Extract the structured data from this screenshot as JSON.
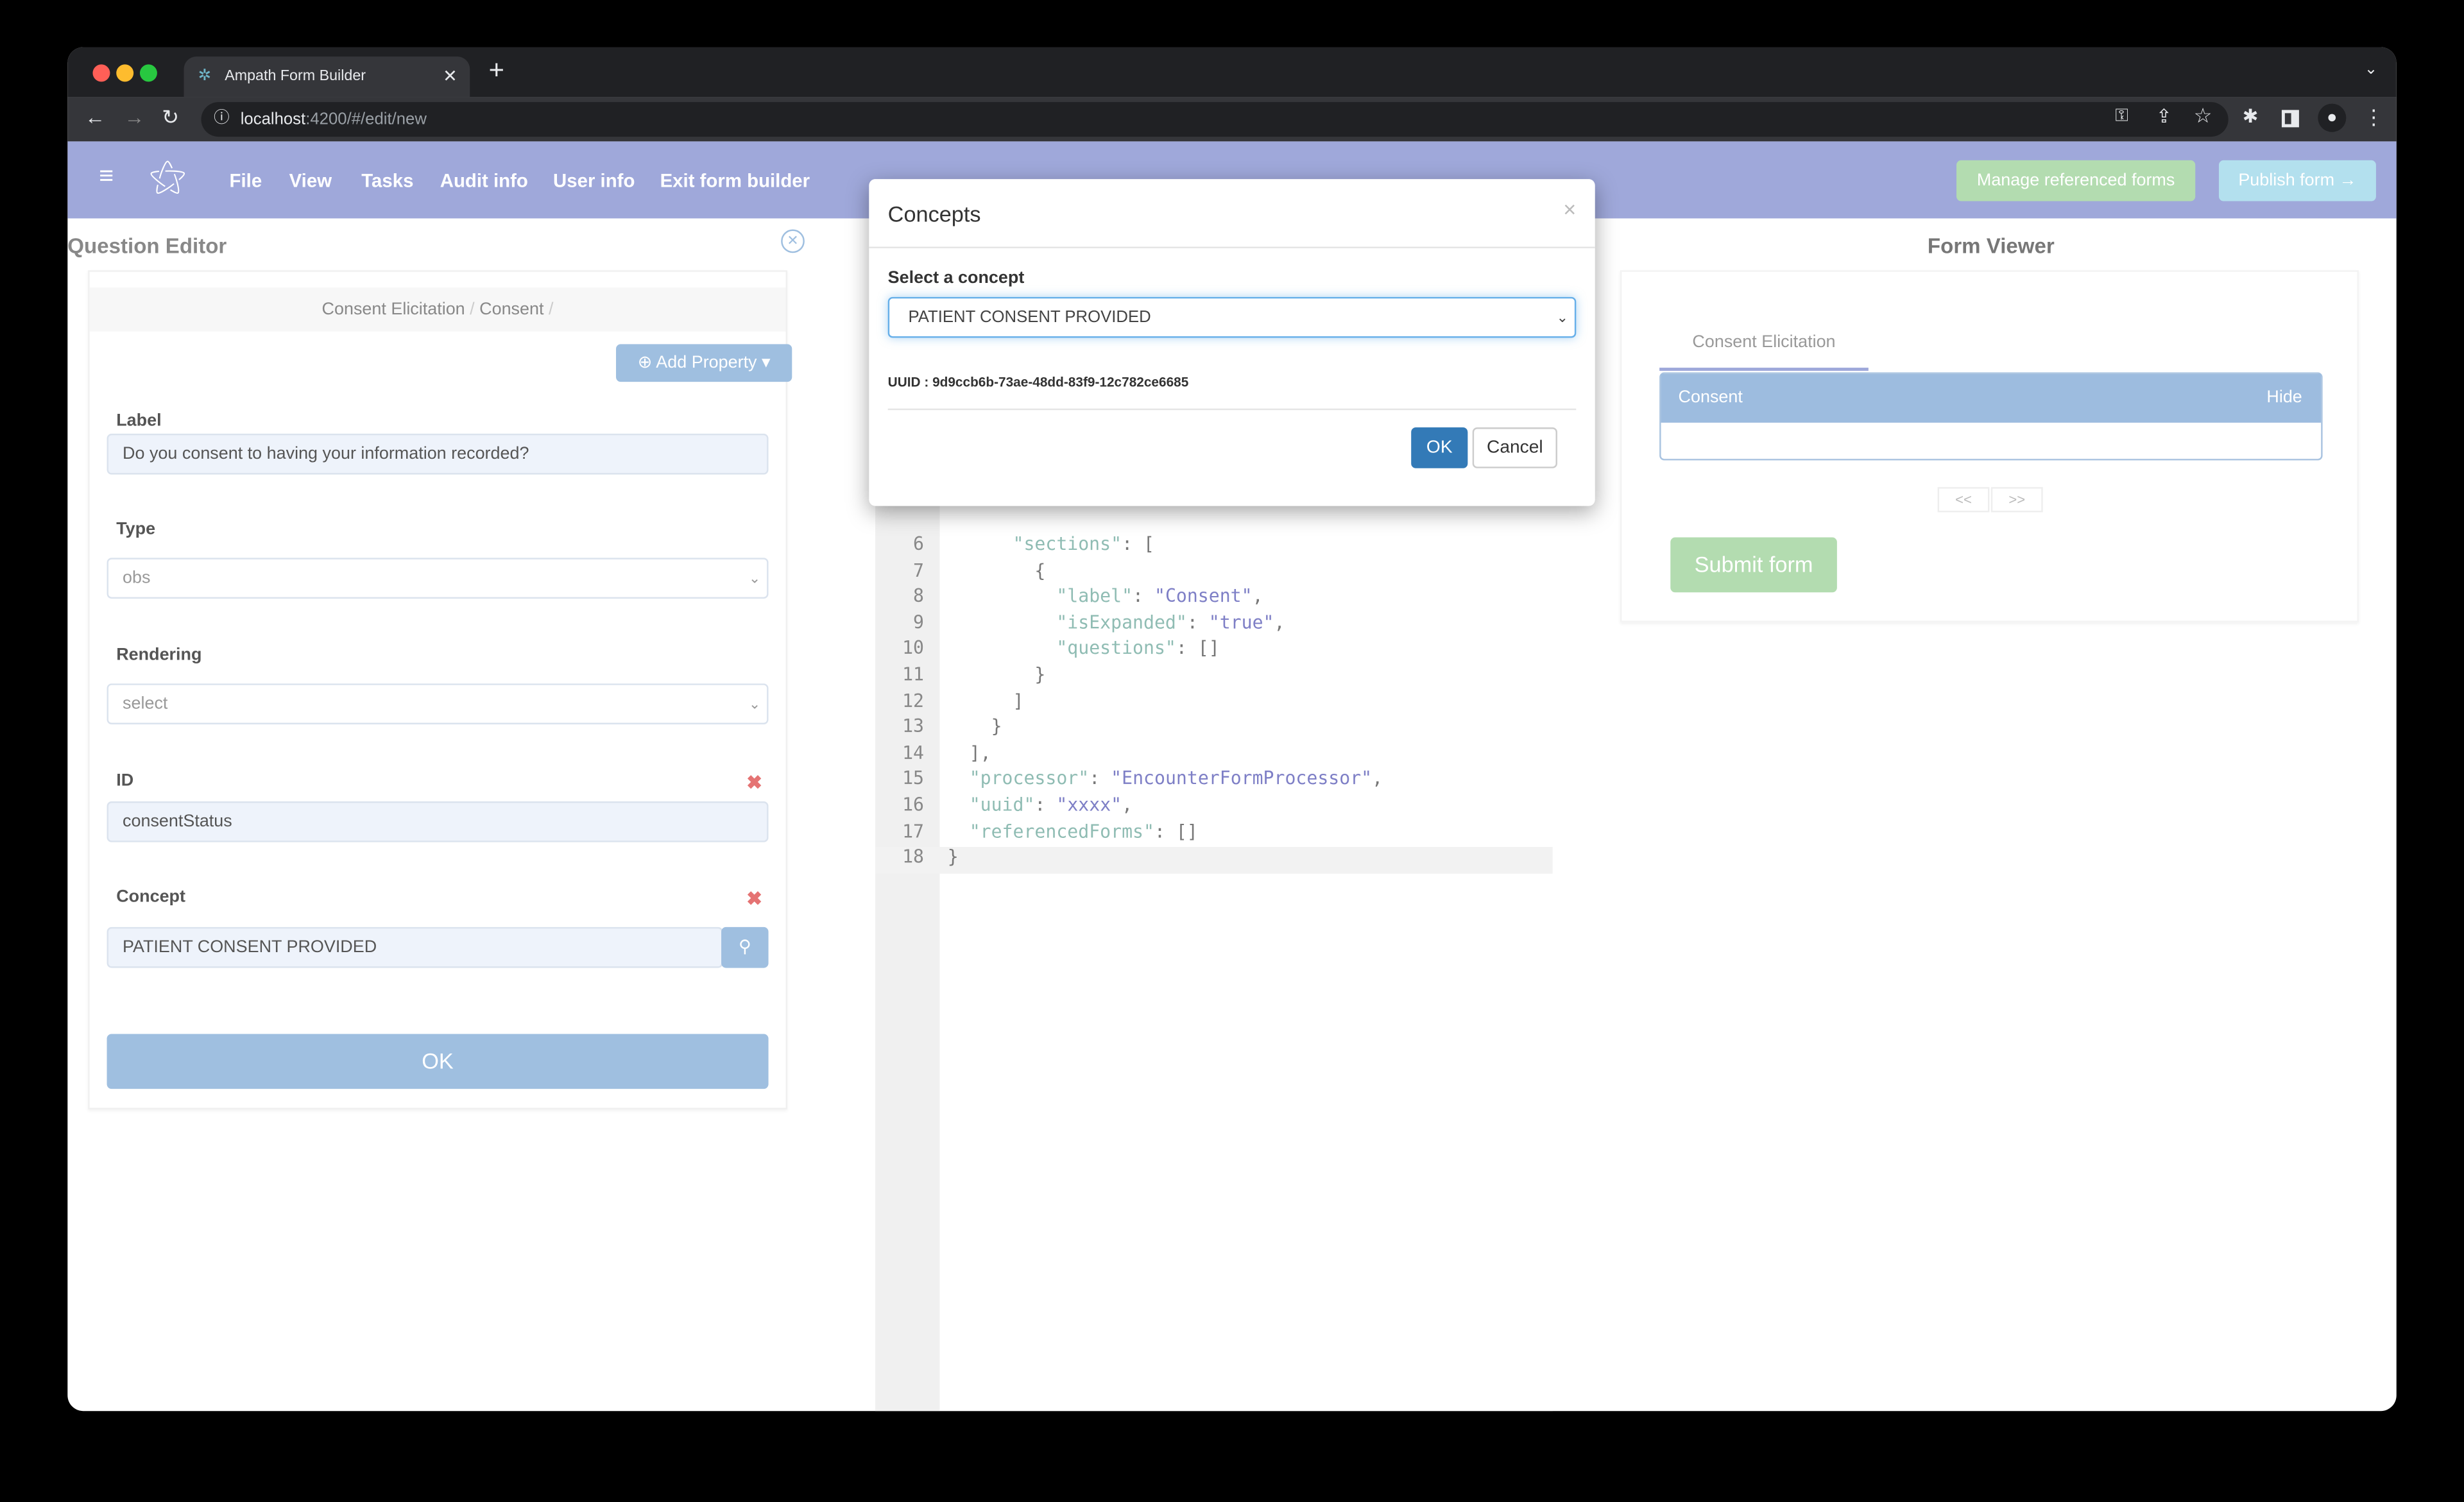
{
  "browser": {
    "tab_title": "Ampath Form Builder",
    "url_host": "localhost",
    "url_rest": ":4200/#/edit/new"
  },
  "nav": {
    "menu": [
      "File",
      "View",
      "Tasks",
      "Audit info",
      "User info",
      "Exit form builder"
    ],
    "manage_label": "Manage referenced forms",
    "publish_label": "Publish form →"
  },
  "question_editor": {
    "title": "Question Editor",
    "breadcrumb": [
      "Consent Elicitation",
      "Consent"
    ],
    "add_property": "Add Property",
    "fields": {
      "label": {
        "label": "Label",
        "value": "Do you consent to having your information recorded?"
      },
      "type": {
        "label": "Type",
        "value": "obs"
      },
      "rendering": {
        "label": "Rendering",
        "value": "select"
      },
      "id": {
        "label": "ID",
        "value": "consentStatus"
      },
      "concept": {
        "label": "Concept",
        "value": "PATIENT CONSENT PROVIDED"
      }
    },
    "ok_label": "OK"
  },
  "editor": {
    "lines": [
      {
        "n": "6",
        "indent": "      ",
        "key": "\"sections\"",
        "sep": ": [",
        "val": "",
        "end": ""
      },
      {
        "n": "7",
        "indent": "        ",
        "key": "",
        "sep": "{",
        "val": "",
        "end": ""
      },
      {
        "n": "8",
        "indent": "          ",
        "key": "\"label\"",
        "sep": ": ",
        "val": "\"Consent\"",
        "end": ","
      },
      {
        "n": "9",
        "indent": "          ",
        "key": "\"isExpanded\"",
        "sep": ": ",
        "val": "\"true\"",
        "end": ","
      },
      {
        "n": "10",
        "indent": "          ",
        "key": "\"questions\"",
        "sep": ": []",
        "val": "",
        "end": ""
      },
      {
        "n": "11",
        "indent": "        ",
        "key": "",
        "sep": "}",
        "val": "",
        "end": ""
      },
      {
        "n": "12",
        "indent": "      ",
        "key": "",
        "sep": "]",
        "val": "",
        "end": ""
      },
      {
        "n": "13",
        "indent": "    ",
        "key": "",
        "sep": "}",
        "val": "",
        "end": ""
      },
      {
        "n": "14",
        "indent": "  ",
        "key": "",
        "sep": "],",
        "val": "",
        "end": ""
      },
      {
        "n": "15",
        "indent": "  ",
        "key": "\"processor\"",
        "sep": ": ",
        "val": "\"EncounterFormProcessor\"",
        "end": ","
      },
      {
        "n": "16",
        "indent": "  ",
        "key": "\"uuid\"",
        "sep": ": ",
        "val": "\"xxxx\"",
        "end": ","
      },
      {
        "n": "17",
        "indent": "  ",
        "key": "\"referencedForms\"",
        "sep": ": []",
        "val": "",
        "end": ""
      },
      {
        "n": "18",
        "indent": "",
        "key": "",
        "sep": "}",
        "val": "",
        "end": ""
      }
    ]
  },
  "modal": {
    "title": "Concepts",
    "close": "×",
    "select_label": "Select a concept",
    "selected": "PATIENT CONSENT PROVIDED",
    "uuid_text": "UUID : 9d9ccb6b-73ae-48dd-83f9-12c782ce6685",
    "ok": "OK",
    "cancel": "Cancel"
  },
  "form_viewer": {
    "title": "Form Viewer",
    "tab": "Consent Elicitation",
    "section": "Consent",
    "hide": "Hide",
    "prev": "<<",
    "next": ">>",
    "submit": "Submit form"
  },
  "colors": {
    "nav": "#9fa8da",
    "primary": "#337ab7",
    "light_blue": "#9fbfe0",
    "green": "#b3dcb0"
  }
}
